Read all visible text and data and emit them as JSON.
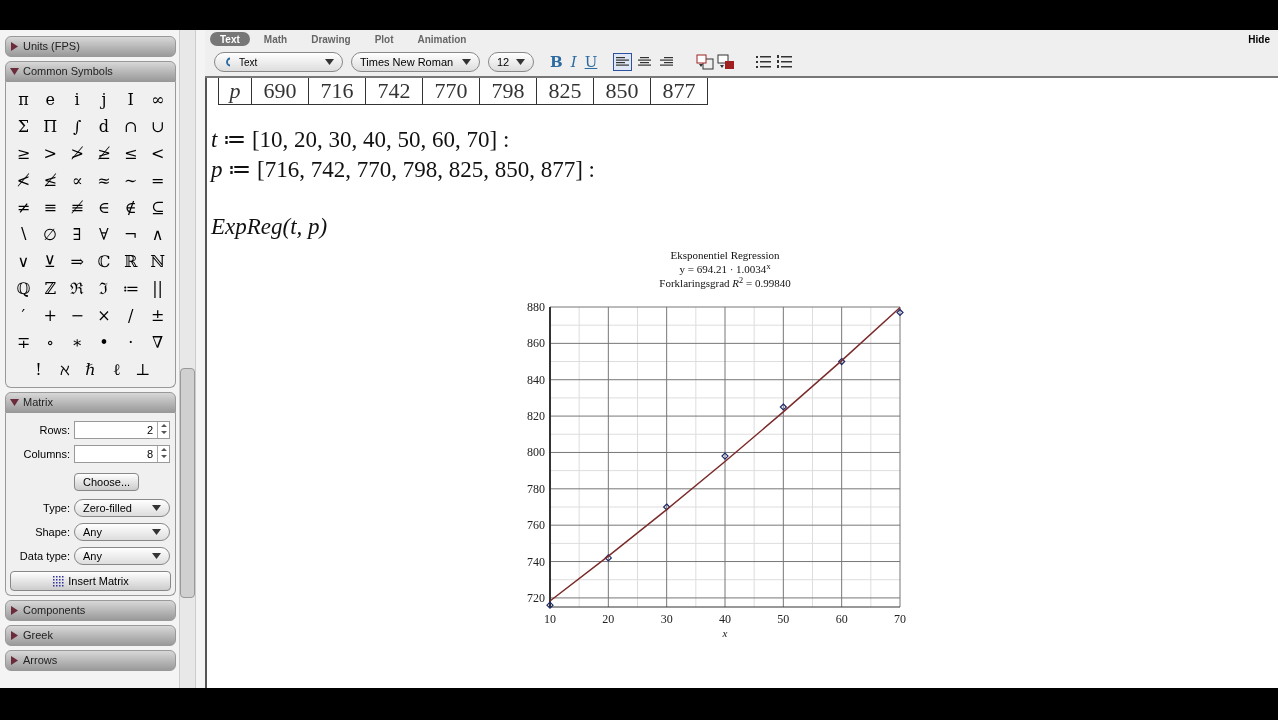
{
  "palette": {
    "sections": [
      {
        "title": "Units (FPS)",
        "expanded": false
      },
      {
        "title": "Common Symbols",
        "expanded": true,
        "symbols": [
          "π",
          "e",
          "i",
          "j",
          "I",
          "∞",
          "Σ",
          "Π",
          "∫",
          "d",
          "∩",
          "∪",
          "≥",
          ">",
          "≯",
          "≱",
          "≤",
          "<",
          "≮",
          "≰",
          "∝",
          "≈",
          "∼",
          "=",
          "≠",
          "≡",
          "≢",
          "∈",
          "∉",
          "⊆",
          "∖",
          "∅",
          "∃",
          "∀",
          "¬",
          "∧",
          "∨",
          "⊻",
          "⇒",
          "ℂ",
          "ℝ",
          "ℕ",
          "ℚ",
          "ℤ",
          "ℜ",
          "ℑ",
          "≔",
          "||",
          "′",
          "+",
          "−",
          "×",
          "/",
          "±",
          "∓",
          "∘",
          "∗",
          "•",
          "·",
          "∇",
          "!",
          "ℵ",
          "ℏ",
          "ℓ",
          "⊥"
        ]
      },
      {
        "title": "Matrix",
        "expanded": true,
        "form": {
          "rows_label": "Rows:",
          "rows": "2",
          "columns_label": "Columns:",
          "columns": "8",
          "choose": "Choose...",
          "type_label": "Type:",
          "type": "Zero-filled",
          "shape_label": "Shape:",
          "shape": "Any",
          "data_type_label": "Data type:",
          "data_type": "Any",
          "insert": "Insert Matrix"
        }
      },
      {
        "title": "Components",
        "expanded": false
      },
      {
        "title": "Greek",
        "expanded": false
      },
      {
        "title": "Arrows",
        "expanded": false
      }
    ]
  },
  "toolbar": {
    "tabs": [
      {
        "label": "Text",
        "selected": true
      },
      {
        "label": "Math",
        "selected": false
      },
      {
        "label": "Drawing",
        "selected": false
      },
      {
        "label": "Plot",
        "selected": false
      },
      {
        "label": "Animation",
        "selected": false
      }
    ],
    "hide": "Hide",
    "style": "Text",
    "font": "Times New Roman",
    "size": "12",
    "bold": "B",
    "italic": "I",
    "underline": "U",
    "alignment": [
      {
        "kind": "left",
        "selected": true
      },
      {
        "kind": "center",
        "selected": false
      },
      {
        "kind": "right",
        "selected": false
      }
    ]
  },
  "document": {
    "table_row": [
      "p",
      "690",
      "716",
      "742",
      "770",
      "798",
      "825",
      "850",
      "877"
    ],
    "lines": [
      "*t* ≔ [10, 20, 30, 40, 50, 60, 70] :",
      "*p* ≔ [716, 742, 770, 798, 825, 850, 877] :"
    ],
    "command": "ExpReg(t, p)",
    "chart_data": {
      "type": "scatter",
      "title": "Eksponentiel Regression",
      "annotations": [
        "y = 694.21 · 1.0034$^{x}$",
        "Forklaringsgrad *R*$^{2}$ = 0.99840"
      ],
      "xlabel": "x",
      "x": [
        10,
        20,
        30,
        40,
        50,
        60,
        70
      ],
      "series": [
        {
          "type": "scatter",
          "color": "#1f2a6b",
          "values": [
            716,
            742,
            770,
            798,
            825,
            850,
            877
          ]
        },
        {
          "type": "line",
          "color": "#7a2a2a",
          "values": [
            718.3,
            743.0,
            768.6,
            795.0,
            822.3,
            850.5,
            879.7
          ]
        }
      ],
      "grid": true,
      "xlim": [
        10,
        70
      ],
      "ylim": [
        715,
        880
      ],
      "xticks": [
        10,
        20,
        30,
        40,
        50,
        60,
        70
      ],
      "yticks": [
        720,
        740,
        760,
        780,
        800,
        820,
        840,
        860,
        880
      ]
    }
  }
}
